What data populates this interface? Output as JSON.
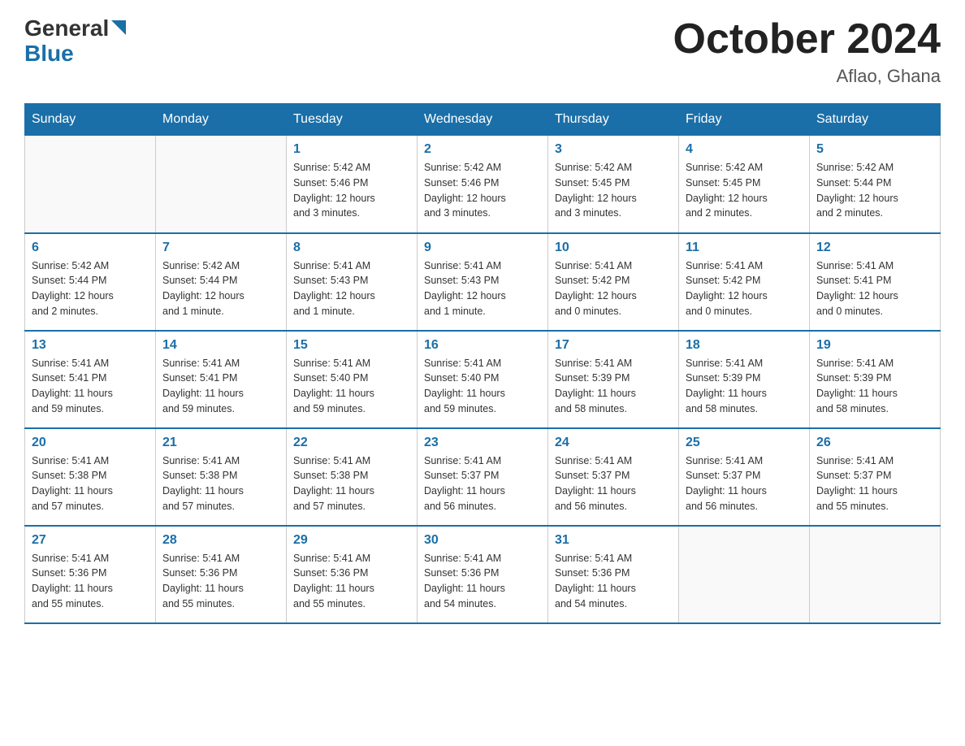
{
  "header": {
    "logo": {
      "general": "General",
      "blue": "Blue"
    },
    "title": "October 2024",
    "location": "Aflao, Ghana"
  },
  "days_of_week": [
    "Sunday",
    "Monday",
    "Tuesday",
    "Wednesday",
    "Thursday",
    "Friday",
    "Saturday"
  ],
  "weeks": [
    [
      {
        "day": "",
        "info": ""
      },
      {
        "day": "",
        "info": ""
      },
      {
        "day": "1",
        "info": "Sunrise: 5:42 AM\nSunset: 5:46 PM\nDaylight: 12 hours\nand 3 minutes."
      },
      {
        "day": "2",
        "info": "Sunrise: 5:42 AM\nSunset: 5:46 PM\nDaylight: 12 hours\nand 3 minutes."
      },
      {
        "day": "3",
        "info": "Sunrise: 5:42 AM\nSunset: 5:45 PM\nDaylight: 12 hours\nand 3 minutes."
      },
      {
        "day": "4",
        "info": "Sunrise: 5:42 AM\nSunset: 5:45 PM\nDaylight: 12 hours\nand 2 minutes."
      },
      {
        "day": "5",
        "info": "Sunrise: 5:42 AM\nSunset: 5:44 PM\nDaylight: 12 hours\nand 2 minutes."
      }
    ],
    [
      {
        "day": "6",
        "info": "Sunrise: 5:42 AM\nSunset: 5:44 PM\nDaylight: 12 hours\nand 2 minutes."
      },
      {
        "day": "7",
        "info": "Sunrise: 5:42 AM\nSunset: 5:44 PM\nDaylight: 12 hours\nand 1 minute."
      },
      {
        "day": "8",
        "info": "Sunrise: 5:41 AM\nSunset: 5:43 PM\nDaylight: 12 hours\nand 1 minute."
      },
      {
        "day": "9",
        "info": "Sunrise: 5:41 AM\nSunset: 5:43 PM\nDaylight: 12 hours\nand 1 minute."
      },
      {
        "day": "10",
        "info": "Sunrise: 5:41 AM\nSunset: 5:42 PM\nDaylight: 12 hours\nand 0 minutes."
      },
      {
        "day": "11",
        "info": "Sunrise: 5:41 AM\nSunset: 5:42 PM\nDaylight: 12 hours\nand 0 minutes."
      },
      {
        "day": "12",
        "info": "Sunrise: 5:41 AM\nSunset: 5:41 PM\nDaylight: 12 hours\nand 0 minutes."
      }
    ],
    [
      {
        "day": "13",
        "info": "Sunrise: 5:41 AM\nSunset: 5:41 PM\nDaylight: 11 hours\nand 59 minutes."
      },
      {
        "day": "14",
        "info": "Sunrise: 5:41 AM\nSunset: 5:41 PM\nDaylight: 11 hours\nand 59 minutes."
      },
      {
        "day": "15",
        "info": "Sunrise: 5:41 AM\nSunset: 5:40 PM\nDaylight: 11 hours\nand 59 minutes."
      },
      {
        "day": "16",
        "info": "Sunrise: 5:41 AM\nSunset: 5:40 PM\nDaylight: 11 hours\nand 59 minutes."
      },
      {
        "day": "17",
        "info": "Sunrise: 5:41 AM\nSunset: 5:39 PM\nDaylight: 11 hours\nand 58 minutes."
      },
      {
        "day": "18",
        "info": "Sunrise: 5:41 AM\nSunset: 5:39 PM\nDaylight: 11 hours\nand 58 minutes."
      },
      {
        "day": "19",
        "info": "Sunrise: 5:41 AM\nSunset: 5:39 PM\nDaylight: 11 hours\nand 58 minutes."
      }
    ],
    [
      {
        "day": "20",
        "info": "Sunrise: 5:41 AM\nSunset: 5:38 PM\nDaylight: 11 hours\nand 57 minutes."
      },
      {
        "day": "21",
        "info": "Sunrise: 5:41 AM\nSunset: 5:38 PM\nDaylight: 11 hours\nand 57 minutes."
      },
      {
        "day": "22",
        "info": "Sunrise: 5:41 AM\nSunset: 5:38 PM\nDaylight: 11 hours\nand 57 minutes."
      },
      {
        "day": "23",
        "info": "Sunrise: 5:41 AM\nSunset: 5:37 PM\nDaylight: 11 hours\nand 56 minutes."
      },
      {
        "day": "24",
        "info": "Sunrise: 5:41 AM\nSunset: 5:37 PM\nDaylight: 11 hours\nand 56 minutes."
      },
      {
        "day": "25",
        "info": "Sunrise: 5:41 AM\nSunset: 5:37 PM\nDaylight: 11 hours\nand 56 minutes."
      },
      {
        "day": "26",
        "info": "Sunrise: 5:41 AM\nSunset: 5:37 PM\nDaylight: 11 hours\nand 55 minutes."
      }
    ],
    [
      {
        "day": "27",
        "info": "Sunrise: 5:41 AM\nSunset: 5:36 PM\nDaylight: 11 hours\nand 55 minutes."
      },
      {
        "day": "28",
        "info": "Sunrise: 5:41 AM\nSunset: 5:36 PM\nDaylight: 11 hours\nand 55 minutes."
      },
      {
        "day": "29",
        "info": "Sunrise: 5:41 AM\nSunset: 5:36 PM\nDaylight: 11 hours\nand 55 minutes."
      },
      {
        "day": "30",
        "info": "Sunrise: 5:41 AM\nSunset: 5:36 PM\nDaylight: 11 hours\nand 54 minutes."
      },
      {
        "day": "31",
        "info": "Sunrise: 5:41 AM\nSunset: 5:36 PM\nDaylight: 11 hours\nand 54 minutes."
      },
      {
        "day": "",
        "info": ""
      },
      {
        "day": "",
        "info": ""
      }
    ]
  ]
}
